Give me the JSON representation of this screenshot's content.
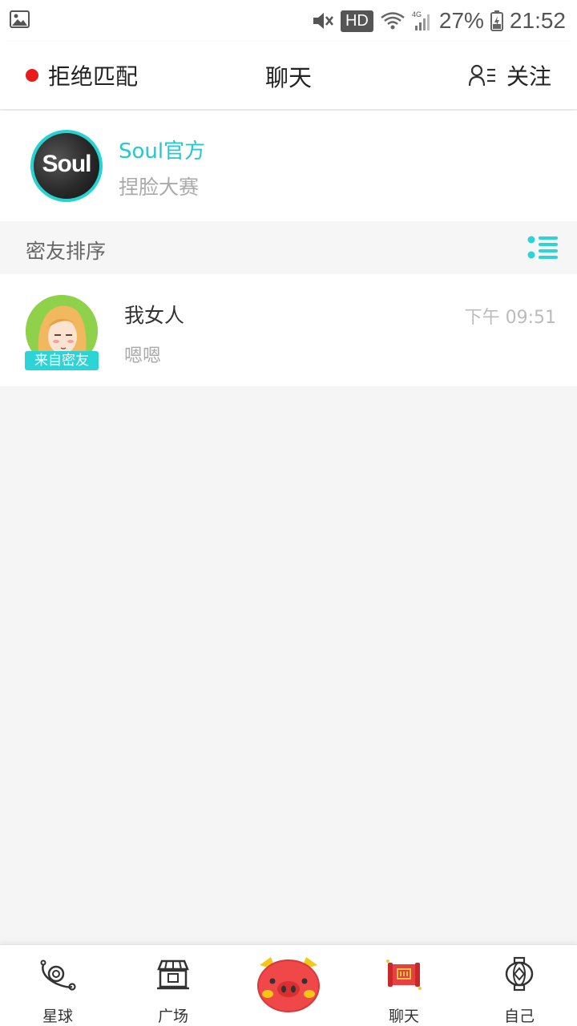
{
  "status_bar": {
    "hd": "HD",
    "network": "4G",
    "battery": "27%",
    "time": "21:52",
    "icons": [
      "gallery-icon",
      "mute-icon",
      "wifi-icon",
      "signal-icon",
      "battery-icon"
    ]
  },
  "header": {
    "left_label": "拒绝匹配",
    "title": "聊天",
    "right_label": "关注",
    "status_dot_color": "#e81c1c"
  },
  "official": {
    "avatar_text": "Soul",
    "name": "Soul官方",
    "message": "捏脸大赛",
    "accent_color": "#25c8cc"
  },
  "section": {
    "label": "密友排序",
    "icon": "sort-list-icon"
  },
  "chats": [
    {
      "name": "我女人",
      "message": "嗯嗯",
      "time": "下午 09:51",
      "badge": "来自密友"
    }
  ],
  "bottom_nav": {
    "items": [
      {
        "label": "星球",
        "icon": "planet-icon"
      },
      {
        "label": "广场",
        "icon": "plaza-icon"
      },
      {
        "label": "",
        "icon": "pig-icon"
      },
      {
        "label": "聊天",
        "icon": "chat-scroll-icon"
      },
      {
        "label": "自己",
        "icon": "lantern-icon"
      }
    ]
  }
}
